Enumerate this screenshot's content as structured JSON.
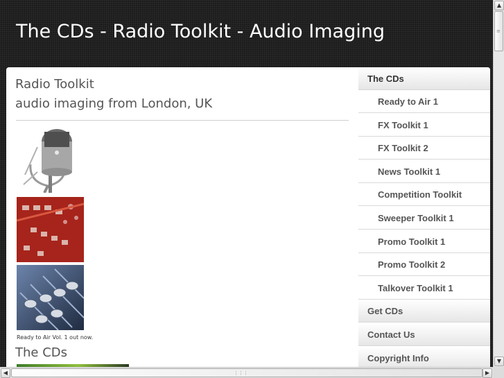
{
  "header": {
    "title": "The CDs - Radio Toolkit - Audio Imaging"
  },
  "main": {
    "intro_line1": "Radio Toolkit",
    "intro_line2": "audio imaging from London, UK",
    "caption": "Ready to Air Vol. 1 out now.",
    "section_heading": "The CDs"
  },
  "nav": {
    "items": [
      {
        "label": "The CDs",
        "level": "top",
        "current": true
      },
      {
        "label": "Ready to Air 1",
        "level": "sub"
      },
      {
        "label": "FX Toolkit 1",
        "level": "sub"
      },
      {
        "label": "FX Toolkit 2",
        "level": "sub"
      },
      {
        "label": "News Toolkit 1",
        "level": "sub"
      },
      {
        "label": "Competition Toolkit",
        "level": "sub"
      },
      {
        "label": "Sweeper Toolkit 1",
        "level": "sub"
      },
      {
        "label": "Promo Toolkit 1",
        "level": "sub"
      },
      {
        "label": "Promo Toolkit 2",
        "level": "sub"
      },
      {
        "label": "Talkover Toolkit 1",
        "level": "sub"
      },
      {
        "label": "Get CDs",
        "level": "top"
      },
      {
        "label": "Contact Us",
        "level": "top"
      },
      {
        "label": "Copyright Info",
        "level": "top"
      }
    ]
  },
  "icons": {
    "scroll_up": "arrow-up-icon",
    "scroll_down": "arrow-down-icon",
    "scroll_left": "arrow-left-icon",
    "scroll_right": "arrow-right-icon"
  },
  "colors": {
    "page_background": "#1c1c1c",
    "nav_text": "#555555",
    "title_text": "#ffffff"
  }
}
